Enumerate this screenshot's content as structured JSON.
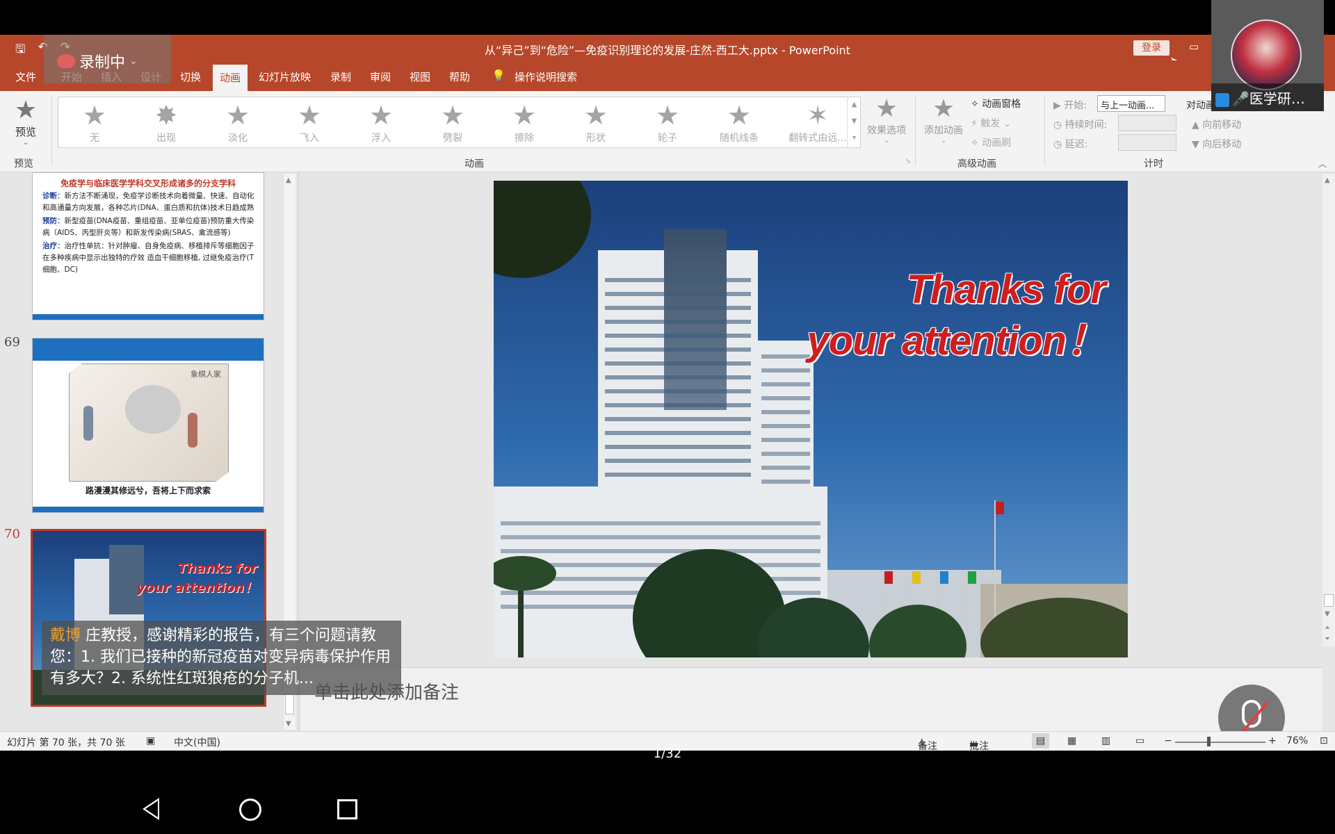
{
  "window": {
    "title": "从“异己”到“危险”—免疫识别理论的发展-庄然-西工大.pptx  -  PowerPoint",
    "login_label": "登录"
  },
  "recording": {
    "label": "录制中"
  },
  "tabs": [
    {
      "label": "文件"
    },
    {
      "label": "开始"
    },
    {
      "label": "插入"
    },
    {
      "label": "设计"
    },
    {
      "label": "切换"
    },
    {
      "label": "动画"
    },
    {
      "label": "幻灯片放映"
    },
    {
      "label": "录制"
    },
    {
      "label": "审阅"
    },
    {
      "label": "视图"
    },
    {
      "label": "帮助"
    },
    {
      "label": "操作说明搜索"
    }
  ],
  "ribbon": {
    "preview": {
      "label": "预览",
      "group": "预览"
    },
    "animations": [
      {
        "label": "无"
      },
      {
        "label": "出现"
      },
      {
        "label": "淡化"
      },
      {
        "label": "飞入"
      },
      {
        "label": "浮入"
      },
      {
        "label": "劈裂"
      },
      {
        "label": "擦除"
      },
      {
        "label": "形状"
      },
      {
        "label": "轮子"
      },
      {
        "label": "随机线条"
      },
      {
        "label": "翻转式由远..."
      }
    ],
    "effect_options": "效果选项",
    "animation_group": "动画",
    "add_animation": "添加动画",
    "animation_pane": "动画窗格",
    "trigger": "触发",
    "painter": "动画刷",
    "advanced_group": "高级动画",
    "start_label": "开始:",
    "start_value": "与上一动画...",
    "duration_label": "持续时间:",
    "delay_label": "延迟:",
    "reorder_label": "对动画",
    "move_earlier": "向前移动",
    "move_later": "向后移动",
    "timing_group": "计时"
  },
  "video": {
    "name": "医学研…"
  },
  "thumbnails": {
    "slide68": {
      "title": "免疫学与临床医学学科交叉形成诸多的分支学科",
      "rows": [
        {
          "k": "诊断",
          "t": "：新方法不断涌现，免疫学诊断技术向着微量、快速、自动化和高通量方向发展，各种芯片(DNA、蛋白质和抗体)技术日趋成熟"
        },
        {
          "k": "预防",
          "t": "：新型疫苗(DNA疫苗、重组疫苗、亚单位疫苗)预防重大传染病（AIDS、丙型肝炎等）和新发传染病(SRAS、禽流感等)"
        },
        {
          "k": "治疗",
          "t": "：治疗性单抗：针对肿瘤、自身免疫病、移植排斥等细胞因子在多种疾病中显示出独特的疗效 造血干细胞移植, 过继免疫治疗(T细胞、DC)"
        }
      ]
    },
    "slide69": {
      "number": "69",
      "caption": "路漫漫其修远兮，吾将上下而求索",
      "seal": "象棋人家"
    },
    "slide70": {
      "number": "70",
      "line1": "Thanks for",
      "line2": "your attention！"
    }
  },
  "slide": {
    "line1": "Thanks for",
    "line2": "your attention！"
  },
  "notes": {
    "placeholder": "单击此处添加备注"
  },
  "chat": {
    "name": "戴博",
    "message": "  庄教授，感谢精彩的报告，有三个问题请教您：1. 我们已接种的新冠疫苗对变异病毒保护作用有多大？2. 系统性红斑狼疮的分子机..."
  },
  "status": {
    "slide_info": "幻灯片 第 70 张，共 70 张",
    "language": "中文(中国)",
    "notes": "备注",
    "comments": "批注",
    "zoom": "76%"
  },
  "page_indicator": "1/32",
  "colors": {
    "accent": "#b7472a",
    "title_red": "#d01d1d",
    "thumb_blue": "#1f6fc0"
  }
}
